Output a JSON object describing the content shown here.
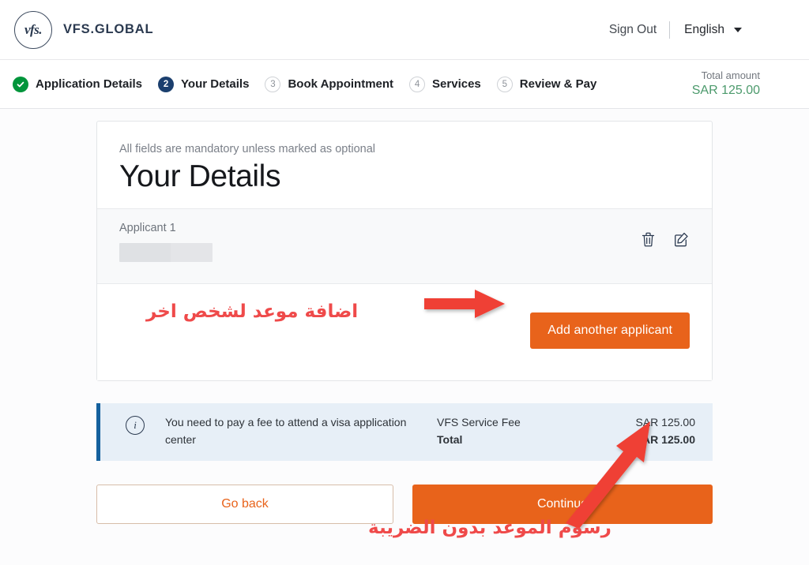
{
  "header": {
    "brand_mark": "vfs.",
    "brand_name": "VFS.GLOBAL",
    "sign_out": "Sign Out",
    "language": "English",
    "caret_icon": "chevron-down-icon"
  },
  "stepper": {
    "steps": [
      {
        "num": "✓",
        "label": "Application Details",
        "state": "done"
      },
      {
        "num": "2",
        "label": "Your Details",
        "state": "active"
      },
      {
        "num": "3",
        "label": "Book Appointment",
        "state": "todo"
      },
      {
        "num": "4",
        "label": "Services",
        "state": "todo"
      },
      {
        "num": "5",
        "label": "Review & Pay",
        "state": "todo"
      }
    ],
    "total_label": "Total amount",
    "total_value": "SAR 125.00"
  },
  "card": {
    "mandatory_note": "All fields are mandatory unless marked as optional",
    "title": "Your Details",
    "applicant_label": "Applicant 1",
    "applicant_name_redacted": "",
    "delete_icon": "trash-icon",
    "edit_icon": "edit-pencil-icon",
    "add_applicant_label": "Add another applicant"
  },
  "info": {
    "icon": "info-circle-icon",
    "message": "You need to pay a fee to attend a visa application center",
    "fees": [
      {
        "name": "VFS Service Fee",
        "amount": "SAR 125.00",
        "bold": false
      },
      {
        "name": "Total",
        "amount": "SAR 125.00",
        "bold": true
      }
    ]
  },
  "footer": {
    "go_back_label": "Go back",
    "continue_label": "Continue"
  },
  "annotations": {
    "top_arabic": "اضافة موعد لشخص اخر",
    "bottom_arabic": "رسوم الموعد بدون الضريبة",
    "arrow_color": "#ef4136",
    "text_color": "#ef4a4a"
  },
  "colors": {
    "brand_navy": "#2b3a50",
    "accent_orange": "#e8631b",
    "step_done_green": "#00953b",
    "step_active_navy": "#1b3f6e",
    "total_green": "#4c9a6c",
    "info_bg": "#e7eff7",
    "info_border": "#15619e"
  }
}
